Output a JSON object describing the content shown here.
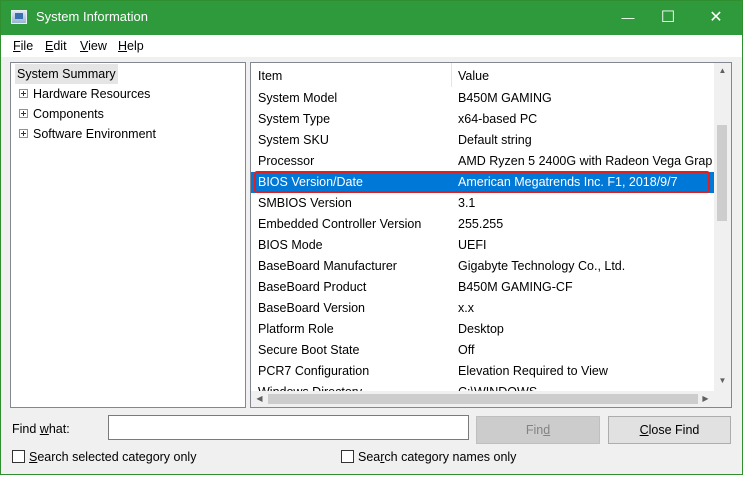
{
  "window": {
    "title": "System Information",
    "controls": {
      "minimize": "—",
      "maximize": "☐",
      "close": "✕"
    }
  },
  "menu": {
    "file": {
      "u": "F",
      "rest": "ile"
    },
    "edit": {
      "u": "E",
      "rest": "dit"
    },
    "view": {
      "u": "V",
      "rest": "iew"
    },
    "help": {
      "u": "H",
      "rest": "elp"
    }
  },
  "tree": {
    "root": "System Summary",
    "children": [
      "Hardware Resources",
      "Components",
      "Software Environment"
    ]
  },
  "list": {
    "columns": {
      "item": "Item",
      "value": "Value"
    },
    "rows": [
      {
        "item": "System Model",
        "value": "B450M GAMING"
      },
      {
        "item": "System Type",
        "value": "x64-based PC"
      },
      {
        "item": "System SKU",
        "value": "Default string"
      },
      {
        "item": "Processor",
        "value": "AMD Ryzen 5 2400G with Radeon Vega Grap"
      },
      {
        "item": "BIOS Version/Date",
        "value": "American Megatrends Inc. F1, 2018/9/7"
      },
      {
        "item": "SMBIOS Version",
        "value": "3.1"
      },
      {
        "item": "Embedded Controller Version",
        "value": "255.255"
      },
      {
        "item": "BIOS Mode",
        "value": "UEFI"
      },
      {
        "item": "BaseBoard Manufacturer",
        "value": "Gigabyte Technology Co., Ltd."
      },
      {
        "item": "BaseBoard Product",
        "value": "B450M GAMING-CF"
      },
      {
        "item": "BaseBoard Version",
        "value": "x.x"
      },
      {
        "item": "Platform Role",
        "value": "Desktop"
      },
      {
        "item": "Secure Boot State",
        "value": "Off"
      },
      {
        "item": "PCR7 Configuration",
        "value": "Elevation Required to View"
      },
      {
        "item": "Windows Directory",
        "value": "C:\\WINDOWS"
      }
    ],
    "selected_index": 4
  },
  "find": {
    "label_pre": "Find ",
    "label_u": "w",
    "label_post": "hat:",
    "input_value": "",
    "find_button": {
      "pre": "Fin",
      "u": "d",
      "post": ""
    },
    "close_find_button": {
      "pre": "",
      "u": "C",
      "post": "lose Find"
    },
    "search_selected": {
      "u": "S",
      "rest": "earch selected category only"
    },
    "search_names": {
      "pre": "Sea",
      "u": "r",
      "post": "ch category names only"
    }
  },
  "colors": {
    "titlebar": "#2e9a3c",
    "selection": "#0078d7",
    "highlight_border": "#e02020"
  }
}
